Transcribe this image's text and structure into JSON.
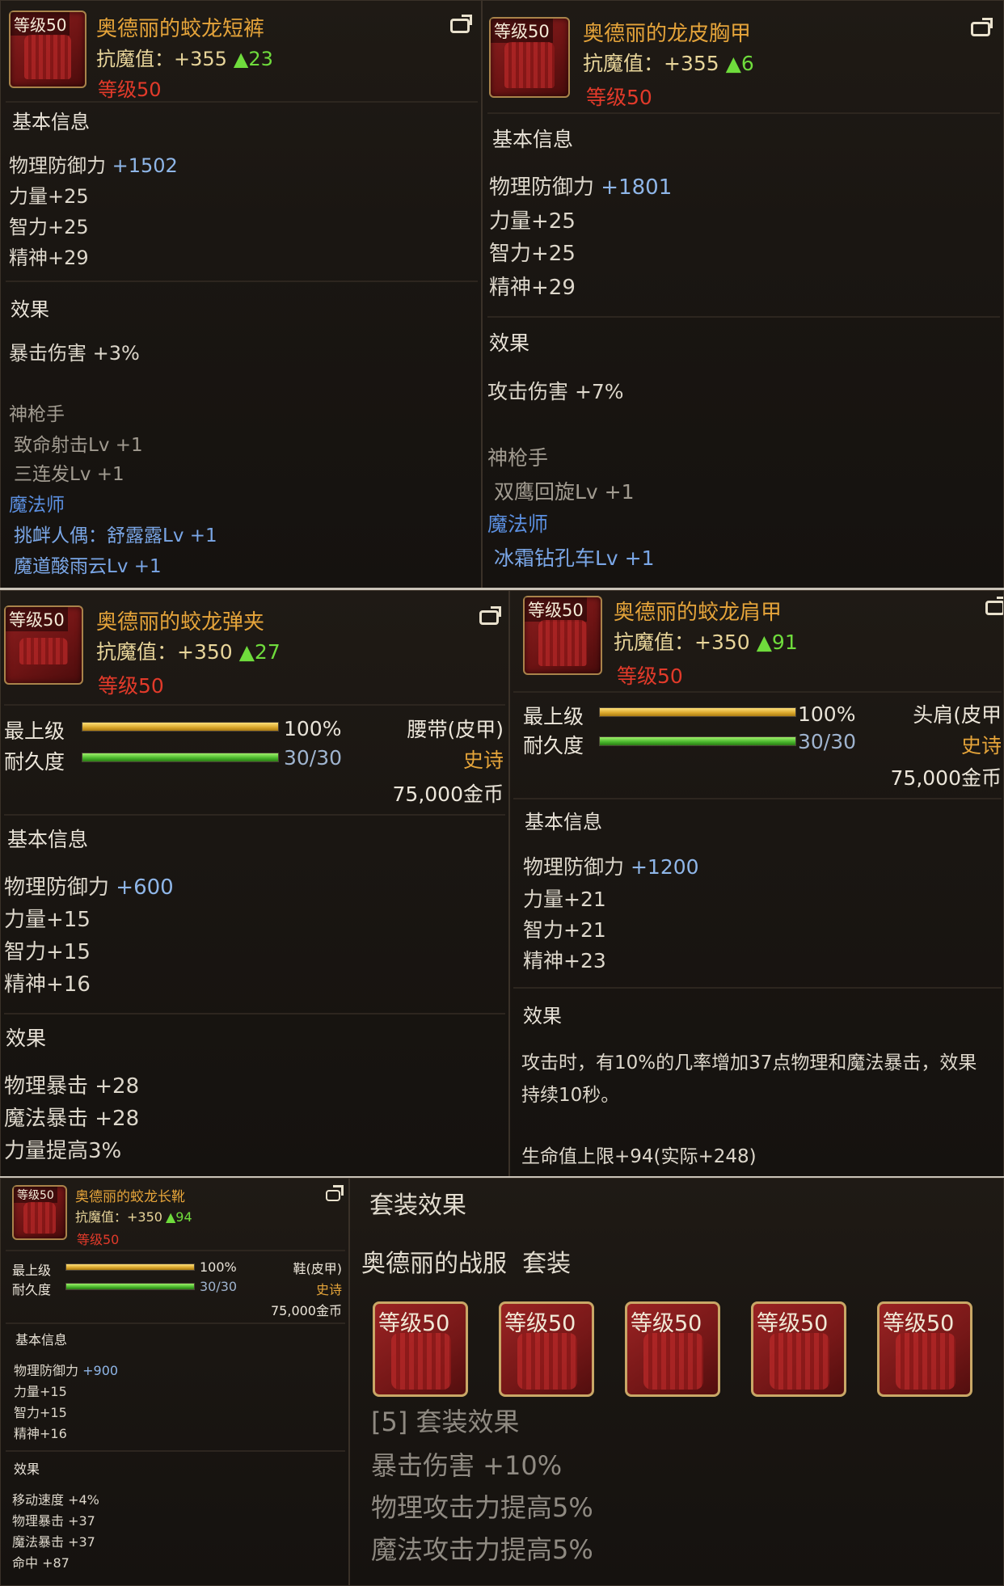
{
  "shorts": {
    "level_tag": "等级50",
    "name": "奥德丽的蛟龙短裤",
    "resist_label": "抗魔值：",
    "resist_value": "+355",
    "resist_up": "▲23",
    "req_level": "等级50",
    "basic_header": "基本信息",
    "phys_def_label": "物理防御力",
    "phys_def_value": "+1502",
    "str": "力量+25",
    "int": "智力+25",
    "spirit": "精神+29",
    "effect_header": "效果",
    "effect1": "暴击伤害 +3%",
    "class1": "神枪手",
    "class1_skill1": "致命射击Lv +1",
    "class1_skill2": "三连发Lv +1",
    "class2": "魔法师",
    "class2_skill1": "挑衅人偶：舒露露Lv +1",
    "class2_skill2": "魔道酸雨云Lv +1"
  },
  "chest": {
    "level_tag": "等级50",
    "name": "奥德丽的龙皮胸甲",
    "resist_label": "抗魔值：",
    "resist_value": "+355",
    "resist_up": "▲6",
    "req_level": "等级50",
    "basic_header": "基本信息",
    "phys_def_label": "物理防御力",
    "phys_def_value": "+1801",
    "str": "力量+25",
    "int": "智力+25",
    "spirit": "精神+29",
    "effect_header": "效果",
    "effect1": "攻击伤害 +7%",
    "class1": "神枪手",
    "class1_skill1": "双鹰回旋Lv +1",
    "class2": "魔法师",
    "class2_skill1": "冰霜钻孔车Lv +1"
  },
  "belt": {
    "level_tag": "等级50",
    "name": "奥德丽的蛟龙弹夹",
    "resist_label": "抗魔值：",
    "resist_value": "+350",
    "resist_up": "▲27",
    "req_level": "等级50",
    "grade_label": "最上级",
    "grade_value": "100%",
    "grade_fraction": 1.0,
    "durability_label": "耐久度",
    "durability_value": "30/30",
    "durability_fraction": 1.0,
    "slot_type": "腰带(皮甲)",
    "rarity": "史诗",
    "price": "75,000金币",
    "basic_header": "基本信息",
    "phys_def_label": "物理防御力",
    "phys_def_value": "+600",
    "str": "力量+15",
    "int": "智力+15",
    "spirit": "精神+16",
    "effect_header": "效果",
    "effect1": "物理暴击 +28",
    "effect2": "魔法暴击 +28",
    "effect3": "力量提高3%"
  },
  "shoulder": {
    "level_tag": "等级50",
    "name": "奥德丽的蛟龙肩甲",
    "resist_label": "抗魔值：",
    "resist_value": "+350",
    "resist_up": "▲91",
    "req_level": "等级50",
    "grade_label": "最上级",
    "grade_value": "100%",
    "grade_fraction": 1.0,
    "durability_label": "耐久度",
    "durability_value": "30/30",
    "durability_fraction": 1.0,
    "slot_type": "头肩(皮甲",
    "rarity": "史诗",
    "price": "75,000金币",
    "basic_header": "基本信息",
    "phys_def_label": "物理防御力",
    "phys_def_value": "+1200",
    "str": "力量+21",
    "int": "智力+21",
    "spirit": "精神+23",
    "effect_header": "效果",
    "effect1_line1": "攻击时，有10%的几率增加37点物理和魔法暴击，效果",
    "effect1_line2": "持续10秒。",
    "effect2": "生命值上限+94(实际+248)"
  },
  "boots": {
    "level_tag": "等级50",
    "name": "奥德丽的蛟龙长靴",
    "resist_label": "抗魔值：",
    "resist_value": "+350",
    "resist_up": "▲94",
    "req_level": "等级50",
    "grade_label": "最上级",
    "grade_value": "100%",
    "grade_fraction": 1.0,
    "durability_label": "耐久度",
    "durability_value": "30/30",
    "durability_fraction": 1.0,
    "slot_type": "鞋(皮甲)",
    "rarity": "史诗",
    "price": "75,000金币",
    "basic_header": "基本信息",
    "phys_def_label": "物理防御力",
    "phys_def_value": "+900",
    "str": "力量+15",
    "int": "智力+15",
    "spirit": "精神+16",
    "effect_header": "效果",
    "effect1": "移动速度 +4%",
    "effect2": "物理暴击 +37",
    "effect3": "魔法暴击 +37",
    "effect4": "命中 +87"
  },
  "set": {
    "header": "套装效果",
    "set_name": "奥德丽的战服",
    "set_suffix": "套装",
    "icons": [
      {
        "level_tag": "等级50",
        "icon": "chest-armor-icon"
      },
      {
        "level_tag": "等级50",
        "icon": "pants-icon"
      },
      {
        "level_tag": "等级50",
        "icon": "shoulder-armor-icon"
      },
      {
        "level_tag": "等级50",
        "icon": "belt-icon"
      },
      {
        "level_tag": "等级50",
        "icon": "boots-icon"
      }
    ],
    "bonus_header": "[5] 套装效果",
    "bonus1": "暴击伤害 +10%",
    "bonus2": "物理攻击力提高5%",
    "bonus3": "魔法攻击力提高5%"
  },
  "colors": {
    "title_gold": "#e5a43a",
    "required_level_red": "#e23a2a",
    "up_arrow_green": "#6fdc3c",
    "stat_blue": "#8fb6e8",
    "class_blue": "#5b8fe0",
    "panel_bg": "#1a1612"
  }
}
